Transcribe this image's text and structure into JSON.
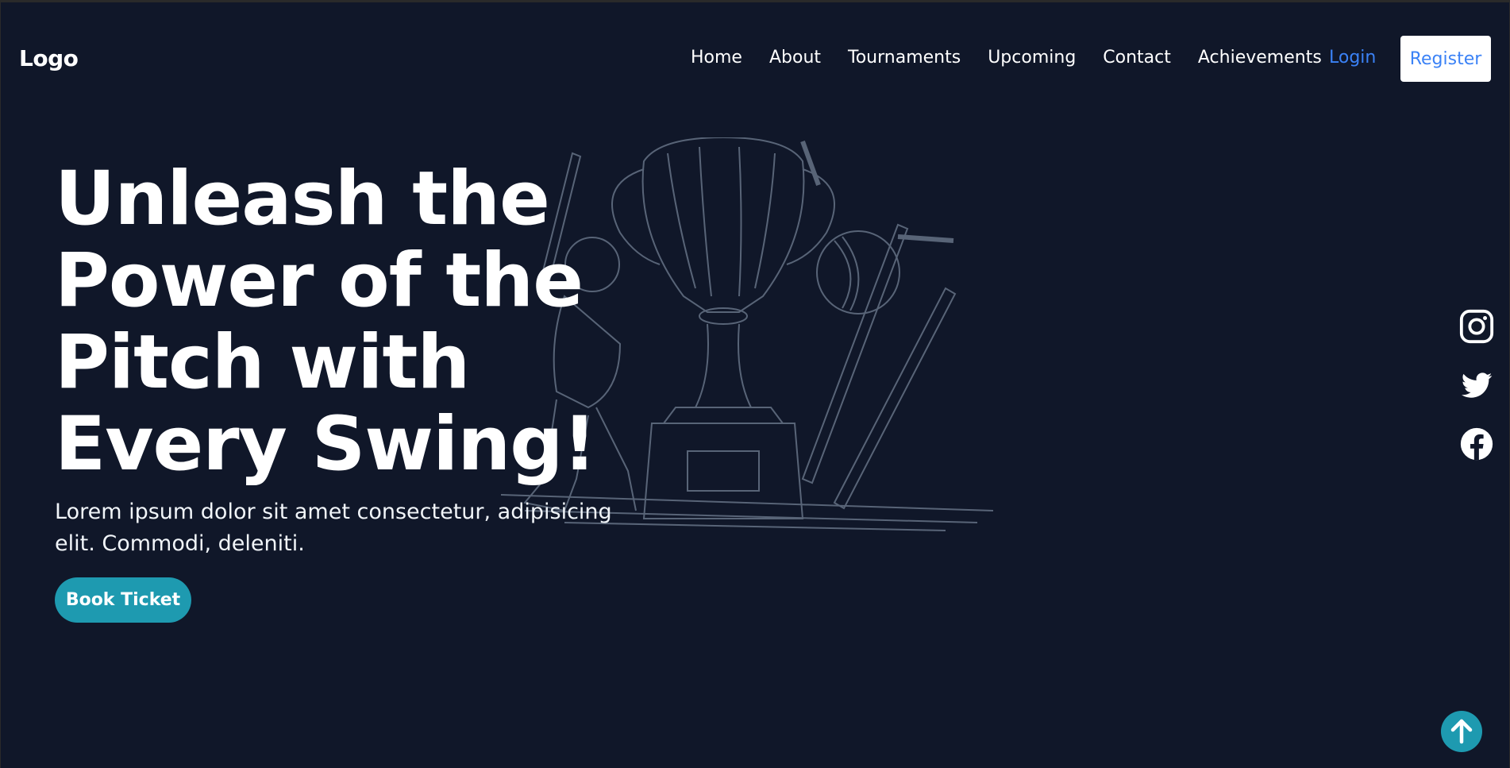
{
  "nav": {
    "logo": "Logo",
    "links": [
      "Home",
      "About",
      "Tournaments",
      "Upcoming",
      "Contact",
      "Achievements"
    ],
    "login": "Login",
    "register": "Register"
  },
  "hero": {
    "title": "Unleash the Power of the Pitch with Every Swing!",
    "subtitle": "Lorem ipsum dolor sit amet consectetur, adipisicing elit. Commodi, deleniti.",
    "cta": "Book Ticket"
  },
  "social": {
    "icons": [
      "instagram-icon",
      "twitter-icon",
      "facebook-icon"
    ]
  },
  "scroll_top": {
    "icon": "arrow-up-icon"
  },
  "colors": {
    "background": "#101729",
    "accent": "#1e9ab0",
    "link_blue": "#3b82f6",
    "text": "#ffffff"
  }
}
